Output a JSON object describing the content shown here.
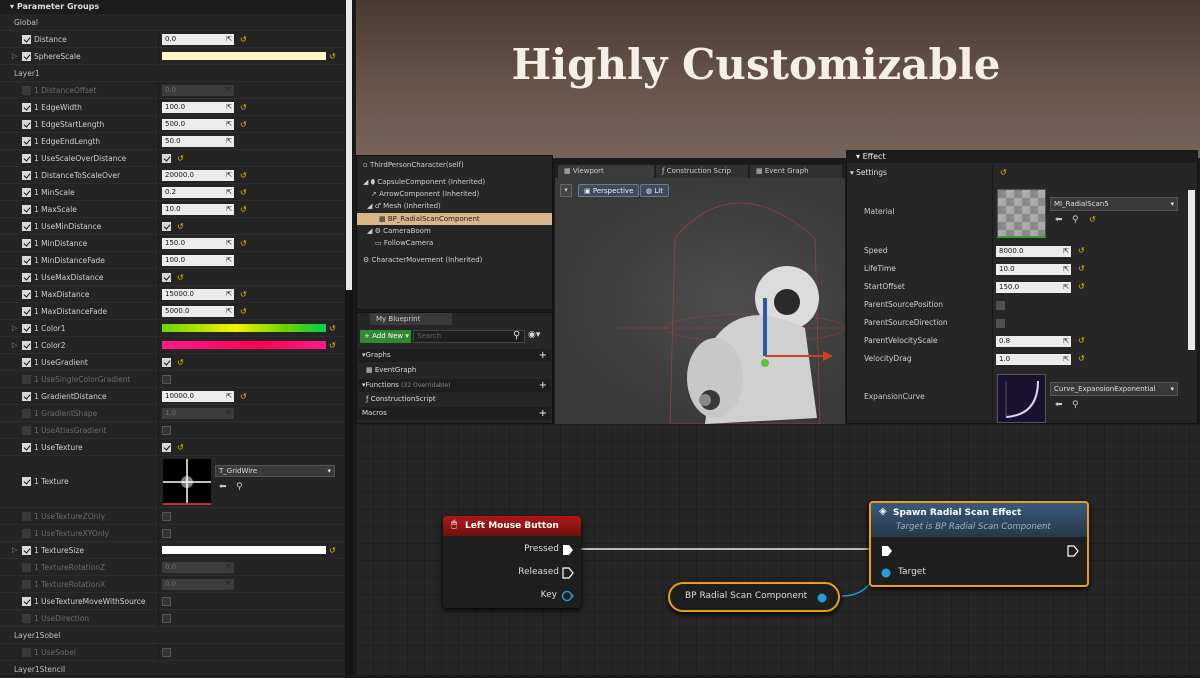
{
  "params": {
    "header": "Parameter Groups",
    "rows": [
      {
        "kind": "group",
        "label": "Global"
      },
      {
        "kind": "num",
        "label": "Distance",
        "value": "0.0",
        "on": true,
        "reset": true
      },
      {
        "kind": "bar",
        "label": "SphereScale",
        "on": true,
        "arrow": true,
        "bar": "#fff8c4"
      },
      {
        "kind": "group",
        "label": "Layer1"
      },
      {
        "kind": "num",
        "label": "1 DistanceOffset",
        "value": "0.0",
        "dis": true
      },
      {
        "kind": "num",
        "label": "1 EdgeWidth",
        "value": "100.0",
        "on": true,
        "reset": true
      },
      {
        "kind": "num",
        "label": "1 EdgeStartLength",
        "value": "500.0",
        "on": true,
        "reset": true
      },
      {
        "kind": "num",
        "label": "1 EdgeEndLength",
        "value": "50.0",
        "on": true
      },
      {
        "kind": "chk",
        "label": "1 UseScaleOverDistance",
        "on": true,
        "vcheck": true,
        "reset": true
      },
      {
        "kind": "num",
        "label": "1 DistanceToScaleOver",
        "value": "20000.0",
        "on": true,
        "reset": true
      },
      {
        "kind": "num",
        "label": "1 MinScale",
        "value": "0.2",
        "on": true,
        "reset": true
      },
      {
        "kind": "num",
        "label": "1 MaxScale",
        "value": "10.0",
        "on": true,
        "reset": true
      },
      {
        "kind": "chk",
        "label": "1 UseMinDistance",
        "on": true,
        "vcheck": true,
        "reset": true
      },
      {
        "kind": "num",
        "label": "1 MinDistance",
        "value": "150.0",
        "on": true,
        "reset": true
      },
      {
        "kind": "num",
        "label": "1 MinDistanceFade",
        "value": "100.0",
        "on": true
      },
      {
        "kind": "chk",
        "label": "1 UseMaxDistance",
        "on": true,
        "vcheck": true,
        "reset": true
      },
      {
        "kind": "num",
        "label": "1 MaxDistance",
        "value": "15000.0",
        "on": true,
        "reset": true
      },
      {
        "kind": "num",
        "label": "1 MaxDistanceFade",
        "value": "5000.0",
        "on": true,
        "reset": true
      },
      {
        "kind": "bar",
        "label": "1 Color1",
        "on": true,
        "arrow": true,
        "bar": "linear-gradient(90deg,#6cd400,#f4f000 45%,#6cd400 75%,#00d050)"
      },
      {
        "kind": "bar",
        "label": "1 Color2",
        "on": true,
        "arrow": true,
        "bar": "linear-gradient(90deg,#ff1a8c,#ff0050 60%,#ff1a8c)"
      },
      {
        "kind": "chk",
        "label": "1 UseGradient",
        "on": true,
        "vcheck": true,
        "reset": true
      },
      {
        "kind": "chk",
        "label": "1 UseSingleColorGradient",
        "dis": true,
        "vcheck": false
      },
      {
        "kind": "num",
        "label": "1 GradientDistance",
        "value": "10000.0",
        "on": true,
        "reset": true
      },
      {
        "kind": "num",
        "label": "1 GradientShape",
        "value": "1.0",
        "dis": true
      },
      {
        "kind": "chk",
        "label": "1 UseAtlasGradient",
        "dis": true,
        "vcheck": false
      },
      {
        "kind": "chk",
        "label": "1 UseTexture",
        "on": true,
        "vcheck": true,
        "reset": true
      }
    ],
    "texture": {
      "label": "1 Texture",
      "asset": "T_GridWire"
    },
    "rows2": [
      {
        "kind": "chk",
        "label": "1 UseTextureZOnly",
        "dis": true,
        "vcheck": false
      },
      {
        "kind": "chk",
        "label": "1 UseTextureXYOnly",
        "dis": true,
        "vcheck": false
      },
      {
        "kind": "bar",
        "label": "1 TextureSize",
        "on": true,
        "arrow": true,
        "bar": "#ffffff"
      },
      {
        "kind": "num",
        "label": "1 TextureRotationZ",
        "value": "0.0",
        "dis": true
      },
      {
        "kind": "num",
        "label": "1 TextureRotationX",
        "value": "0.0",
        "dis": true
      },
      {
        "kind": "chk",
        "label": "1 UseTextureMoveWithSource",
        "on": true,
        "vcheck": false
      },
      {
        "kind": "chk",
        "label": "1 UseDirection",
        "dis": true,
        "vcheck": false
      },
      {
        "kind": "group",
        "label": "Layer1Sobel"
      },
      {
        "kind": "chk",
        "label": "1 UseSobel",
        "dis": true,
        "vcheck": false
      },
      {
        "kind": "group",
        "label": "Layer1Stencil"
      }
    ]
  },
  "banner": {
    "title": "Highly Customizable"
  },
  "components": {
    "root": "ThirdPersonCharacter(self)",
    "items": [
      "CapsuleComponent (Inherited)",
      "ArrowComponent (Inherited)",
      "Mesh (Inherited)",
      "BP_RadialScanComponent",
      "CameraBoom",
      "FollowCamera",
      "CharacterMovement (Inherited)"
    ]
  },
  "blueprint": {
    "tab": "My Blueprint",
    "add_new": "+ Add New ▾",
    "search_placeholder": "Search",
    "graphs": "Graphs",
    "event_graph": "EventGraph",
    "functions": "Functions",
    "overridable": "(32 Overridable)",
    "construction": "ConstructionScript",
    "macros": "Macros"
  },
  "viewport": {
    "tabs": [
      "Viewport",
      "Construction Scrip",
      "Event Graph"
    ],
    "perspective": "Perspective",
    "lit": "Lit"
  },
  "effect": {
    "header": "Effect",
    "settings": "Settings",
    "material_label": "Material",
    "material_asset": "MI_RadialScan5",
    "rows": [
      {
        "label": "Speed",
        "value": "8000.0"
      },
      {
        "label": "LifeTime",
        "value": "10.0"
      },
      {
        "label": "StartOffset",
        "value": "150.0"
      },
      {
        "label": "ParentSourcePosition",
        "check": true
      },
      {
        "label": "ParentSourceDirection",
        "check": true
      },
      {
        "label": "ParentVelocityScale",
        "value": "0.8"
      },
      {
        "label": "VelocityDrag",
        "value": "1.0"
      }
    ],
    "curve_label": "ExpansionCurve",
    "curve_asset": "Curve_ExpansionExponential"
  },
  "graph": {
    "lmb": {
      "title": "Left Mouse Button",
      "pressed": "Pressed",
      "released": "Released",
      "key": "Key"
    },
    "spawn": {
      "title": "Spawn Radial Scan Effect",
      "subtitle": "Target is BP Radial Scan Component",
      "target": "Target"
    },
    "component_node": "BP Radial Scan Component"
  }
}
